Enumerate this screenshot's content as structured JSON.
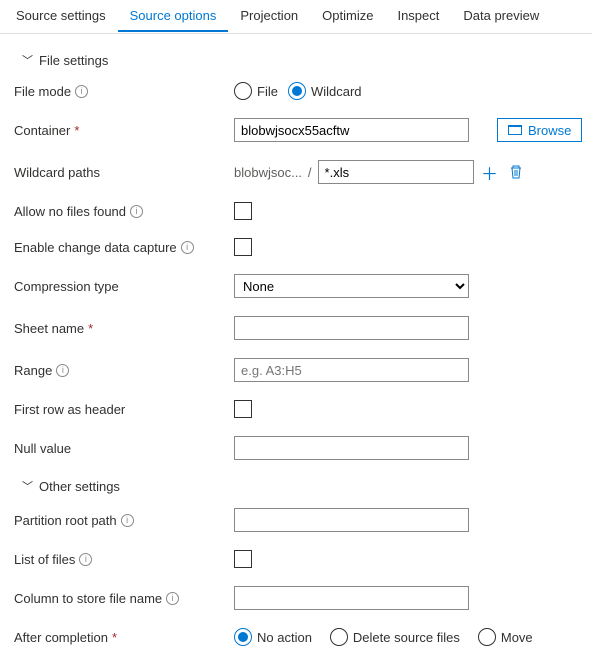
{
  "tabs": {
    "source_settings": "Source settings",
    "source_options": "Source options",
    "projection": "Projection",
    "optimize": "Optimize",
    "inspect": "Inspect",
    "data_preview": "Data preview"
  },
  "sections": {
    "file_settings": "File settings",
    "other_settings": "Other settings"
  },
  "labels": {
    "file_mode": "File mode",
    "container": "Container",
    "wildcard_paths": "Wildcard paths",
    "allow_no_files": "Allow no files found",
    "enable_cdc": "Enable change data capture",
    "compression_type": "Compression type",
    "sheet_name": "Sheet name",
    "range": "Range",
    "first_row_header": "First row as header",
    "null_value": "Null value",
    "partition_root": "Partition root path",
    "list_of_files": "List of files",
    "column_store": "Column to store file name",
    "after_completion": "After completion"
  },
  "file_mode": {
    "file": "File",
    "wildcard": "Wildcard",
    "selected": "wildcard"
  },
  "container": {
    "value": "blobwjsocx55acftw",
    "browse": "Browse"
  },
  "wildcard": {
    "prefix": "blobwjsoc...",
    "value": "*.xls"
  },
  "compression": {
    "selected": "None"
  },
  "range": {
    "placeholder": "e.g. A3:H5"
  },
  "after": {
    "no_action": "No action",
    "delete": "Delete source files",
    "move": "Move",
    "selected": "no_action"
  },
  "asterisk": "*",
  "info_char": "i",
  "slash": "/"
}
